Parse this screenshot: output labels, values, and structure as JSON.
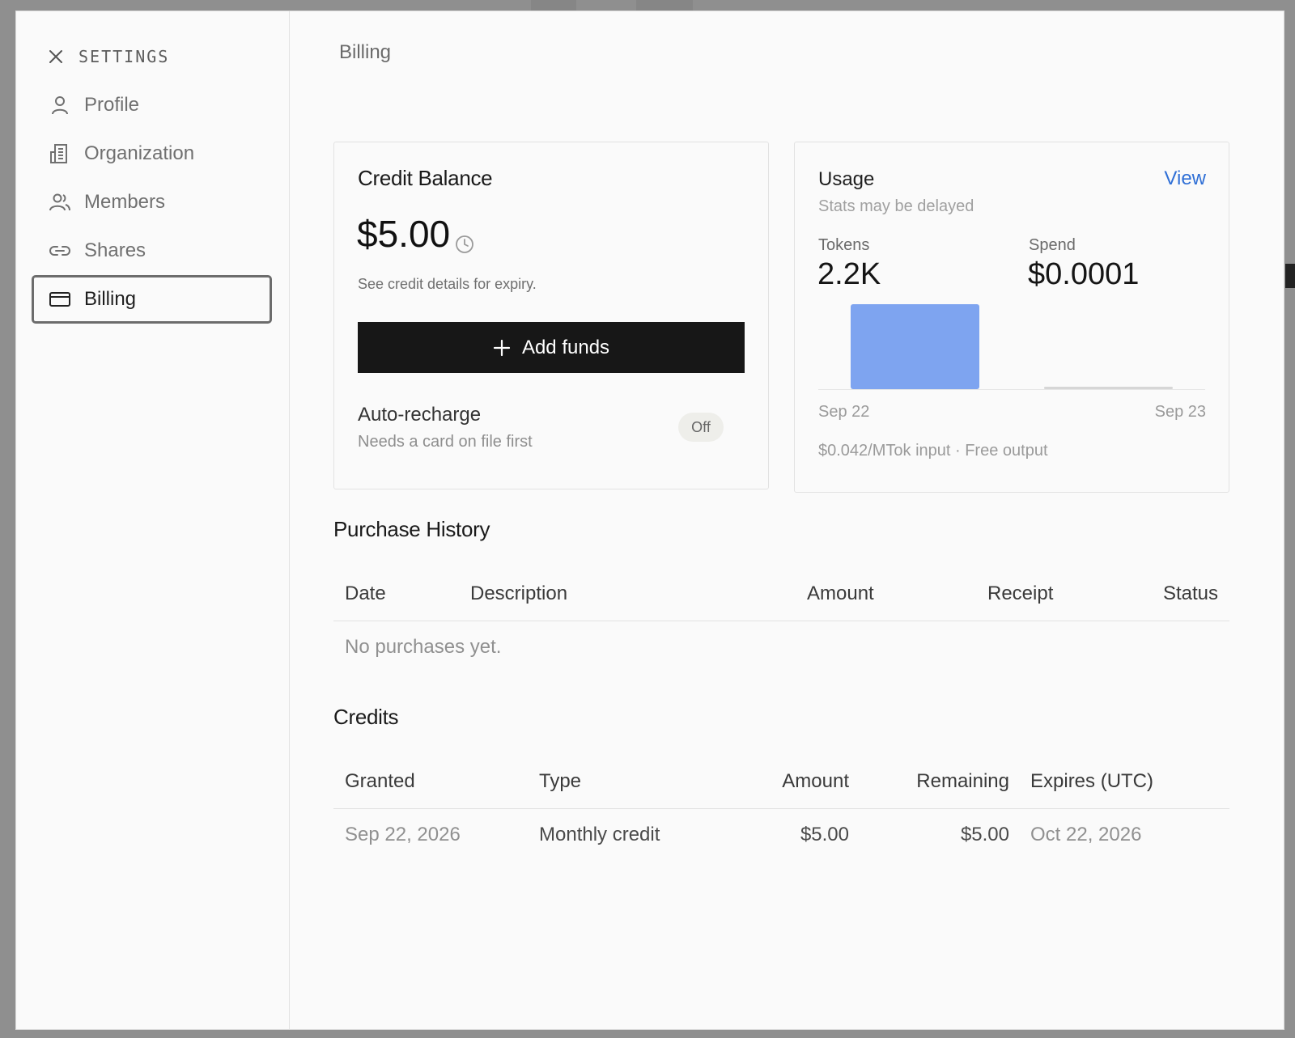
{
  "sidebar": {
    "title": "SETTINGS",
    "items": [
      {
        "label": "Profile",
        "icon": "user-icon",
        "active": false
      },
      {
        "label": "Organization",
        "icon": "building-icon",
        "active": false
      },
      {
        "label": "Members",
        "icon": "users-icon",
        "active": false
      },
      {
        "label": "Shares",
        "icon": "link-icon",
        "active": false
      },
      {
        "label": "Billing",
        "icon": "credit-card-icon",
        "active": true
      }
    ]
  },
  "page": {
    "title": "Billing"
  },
  "credit_card": {
    "title": "Credit Balance",
    "amount": "$5.00",
    "note": "See credit details for expiry.",
    "add_funds_label": "Add funds",
    "auto_recharge_title": "Auto-recharge",
    "auto_recharge_sub": "Needs a card on file first",
    "auto_recharge_state": "Off"
  },
  "usage": {
    "title": "Usage",
    "view_label": "View",
    "subtitle": "Stats may be delayed",
    "tokens_label": "Tokens",
    "tokens_value": "2.2K",
    "spend_label": "Spend",
    "spend_value": "$0.0001",
    "price_note": "$0.042/MTok input · Free output",
    "accent_color": "#7ea4f0"
  },
  "chart_data": {
    "type": "bar",
    "categories": [
      "Sep 22",
      "Sep 23"
    ],
    "values": [
      2200,
      0
    ],
    "x_tick_labels": [
      "Sep 22",
      "Sep 23"
    ],
    "ylim": [
      0,
      2200
    ],
    "grid": false
  },
  "purchase_history": {
    "title": "Purchase History",
    "columns": [
      "Date",
      "Description",
      "Amount",
      "Receipt",
      "Status"
    ],
    "empty_text": "No purchases yet."
  },
  "credits": {
    "title": "Credits",
    "columns": [
      "Granted",
      "Type",
      "Amount",
      "Remaining",
      "Expires (UTC)"
    ],
    "rows": [
      {
        "granted": "Sep 22, 2026",
        "type": "Monthly credit",
        "amount": "$5.00",
        "remaining": "$5.00",
        "expires": "Oct 22, 2026"
      }
    ]
  }
}
